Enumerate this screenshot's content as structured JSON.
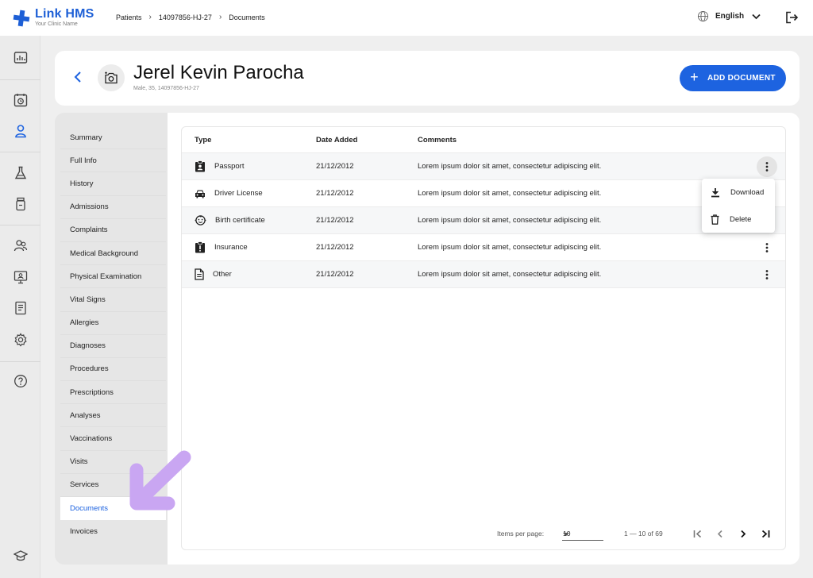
{
  "app": {
    "name": "Link HMS",
    "subtitle": "Your Clinic Name"
  },
  "breadcrumb": [
    "Patients",
    "14097856-HJ-27",
    "Documents"
  ],
  "header": {
    "language": "English"
  },
  "patient": {
    "name": "Jerel Kevin Parocha",
    "meta": "Male, 35, 14097856-HJ-27"
  },
  "actions": {
    "add_document": "ADD DOCUMENT"
  },
  "side_nav": [
    "Summary",
    "Full Info",
    "History",
    "Admissions",
    "Complaints",
    "Medical Background",
    "Physical Examination",
    "Vital Signs",
    "Allergies",
    "Diagnoses",
    "Procedures",
    "Prescriptions",
    "Analyses",
    "Vaccinations",
    "Visits",
    "Services",
    "Documents",
    "Invoices"
  ],
  "side_nav_active": "Documents",
  "table": {
    "columns": {
      "type": "Type",
      "date": "Date Added",
      "comments": "Comments"
    },
    "rows": [
      {
        "type": "Passport",
        "icon": "id-badge-icon",
        "date": "21/12/2012",
        "comment": "Lorem ipsum dolor sit amet, consectetur adipiscing elit."
      },
      {
        "type": "Driver License",
        "icon": "car-icon",
        "date": "21/12/2012",
        "comment": "Lorem ipsum dolor sit amet, consectetur adipiscing elit."
      },
      {
        "type": "Birth certificate",
        "icon": "baby-face-icon",
        "date": "21/12/2012",
        "comment": "Lorem ipsum dolor sit amet, consectetur adipiscing elit."
      },
      {
        "type": "Insurance",
        "icon": "insurance-clipboard-icon",
        "date": "21/12/2012",
        "comment": "Lorem ipsum dolor sit amet, consectetur adipiscing elit."
      },
      {
        "type": "Other",
        "icon": "file-icon",
        "date": "21/12/2012",
        "comment": "Lorem ipsum dolor sit amet, consectetur adipiscing elit."
      }
    ]
  },
  "context_menu": {
    "download": "Download",
    "delete": "Delete"
  },
  "pagination": {
    "label": "Items per page:",
    "per_page": "10",
    "range": "1 — 10 of 69"
  }
}
